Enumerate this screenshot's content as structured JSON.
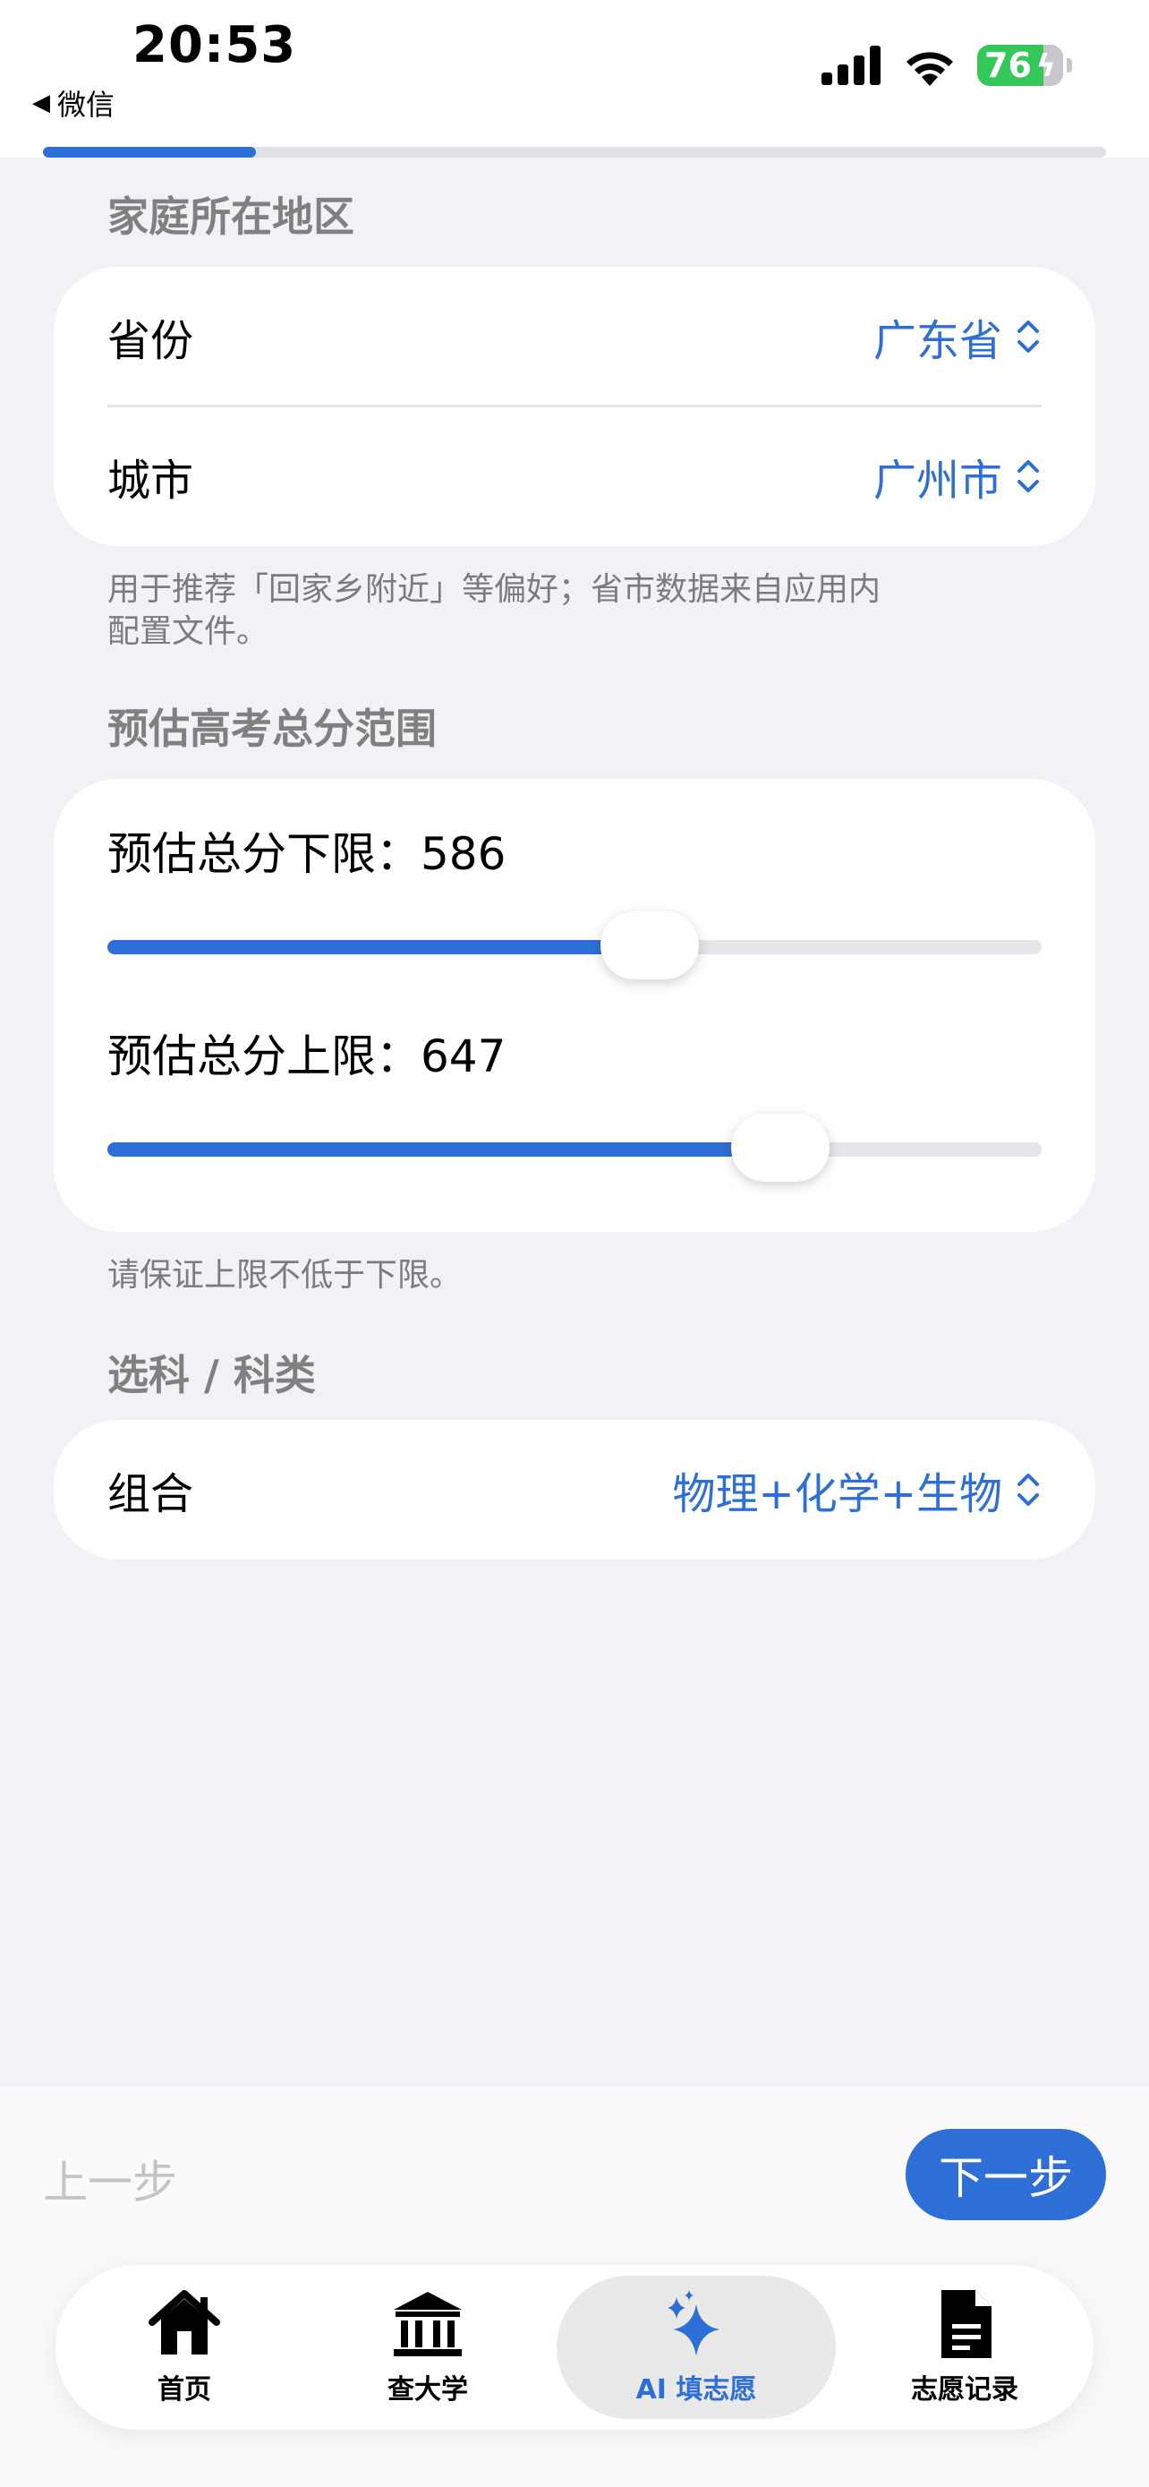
{
  "status_bar": {
    "time": "20:53",
    "back_label": "微信",
    "battery": "76",
    "icons": [
      "cellular-signal-icon",
      "wifi-icon",
      "battery-charging-icon"
    ]
  },
  "progress": {
    "fraction": 0.2
  },
  "region": {
    "title": "家庭所在地区",
    "province_label": "省份",
    "province_value": "广东省",
    "city_label": "城市",
    "city_value": "广州市",
    "note_line1": "用于推荐「回家乡附近」等偏好；省市数据来自应用内",
    "note_line2": "配置文件。"
  },
  "score": {
    "title": "预估高考总分范围",
    "lower_label": "预估总分下限：586",
    "lower_fraction": 0.58,
    "upper_label": "预估总分上限：647",
    "upper_fraction": 0.72,
    "note": "请保证上限不低于下限。"
  },
  "subjects": {
    "title": "选科 / 科类",
    "combo_label": "组合",
    "combo_value": "物理+化学+生物"
  },
  "nav_buttons": {
    "prev": "上一步",
    "next": "下一步"
  },
  "tabs": [
    {
      "label": "首页",
      "icon": "house-icon"
    },
    {
      "label": "查大学",
      "icon": "building-columns-icon"
    },
    {
      "label": "AI 填志愿",
      "icon": "sparkles-icon"
    },
    {
      "label": "志愿记录",
      "icon": "document-icon"
    }
  ],
  "colors": {
    "accent": "#2d6fd6",
    "background": "#f1f1f6"
  }
}
